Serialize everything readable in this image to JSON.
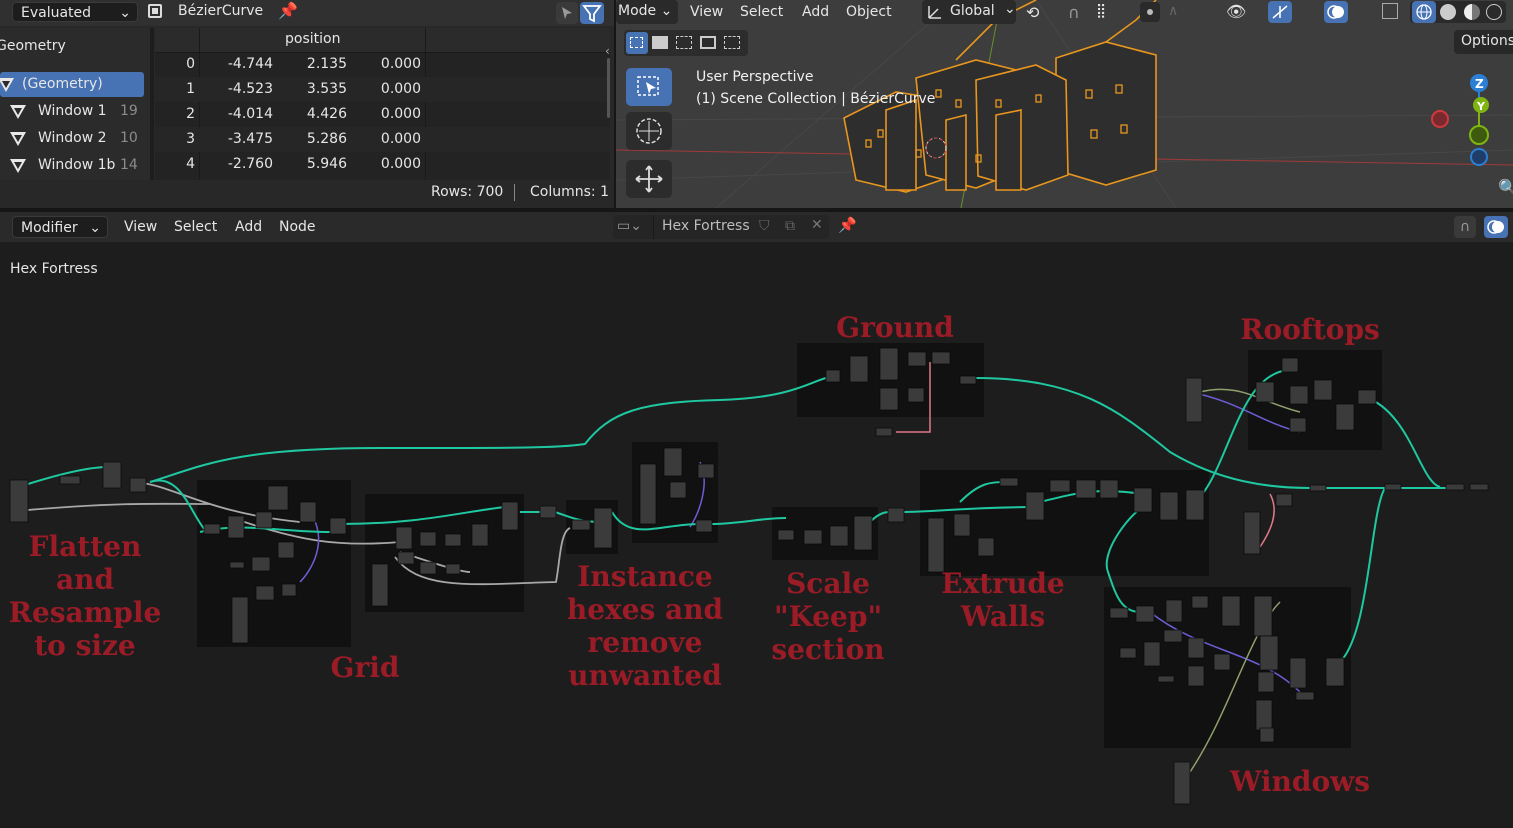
{
  "spreadsheet": {
    "mode": "Evaluated",
    "object_name": "BézierCurve",
    "domain_title": "Geometry",
    "domain_items": [
      {
        "label": "(Geometry)",
        "count": ""
      },
      {
        "label": "Window 1",
        "count": "19"
      },
      {
        "label": "Window 2",
        "count": "10"
      },
      {
        "label": "Window 1b",
        "count": "14"
      }
    ],
    "column_header": "position",
    "rows": [
      {
        "idx": "0",
        "x": "-4.744",
        "y": "2.135",
        "z": "0.000"
      },
      {
        "idx": "1",
        "x": "-4.523",
        "y": "3.535",
        "z": "0.000"
      },
      {
        "idx": "2",
        "x": "-4.014",
        "y": "4.426",
        "z": "0.000"
      },
      {
        "idx": "3",
        "x": "-3.475",
        "y": "5.286",
        "z": "0.000"
      },
      {
        "idx": "4",
        "x": "-2.760",
        "y": "5.946",
        "z": "0.000"
      }
    ],
    "rows_label": "Rows: 700",
    "columns_label": "Columns: 1"
  },
  "viewport": {
    "menus": [
      "Mode",
      "View",
      "Select",
      "Add",
      "Object"
    ],
    "transform_orientation": "Global",
    "options_label": "Options",
    "overlay_line1": "User Perspective",
    "overlay_line2": "(1) Scene Collection | BézierCurve",
    "gizmo_z": "Z",
    "gizmo_y": "Y",
    "colors": {
      "selection": "#e8961e",
      "axis_x": "#d0393e",
      "axis_y": "#7fb511",
      "axis_z": "#2b7fd4"
    }
  },
  "node_editor": {
    "editor_type": "Modifier",
    "menus": [
      "View",
      "Select",
      "Add",
      "Node"
    ],
    "tree_name": "Hex Fortress",
    "breadcrumb": "Hex Fortress",
    "frames": [
      {
        "key": "flatten",
        "label": "Flatten\nand\nResample\nto size"
      },
      {
        "key": "grid",
        "label": "Grid"
      },
      {
        "key": "instance",
        "label": "Instance\nhexes and\nremove\nunwanted"
      },
      {
        "key": "scale",
        "label": "Scale\n\"Keep\"\nsection"
      },
      {
        "key": "ground",
        "label": "Ground"
      },
      {
        "key": "extrude",
        "label": "Extrude\nWalls"
      },
      {
        "key": "rooftops",
        "label": "Rooftops"
      },
      {
        "key": "windows",
        "label": "Windows"
      }
    ],
    "colors": {
      "geometry_wire": "#1fc8a0",
      "label": "#9b1c26",
      "frame": "#111111"
    }
  }
}
